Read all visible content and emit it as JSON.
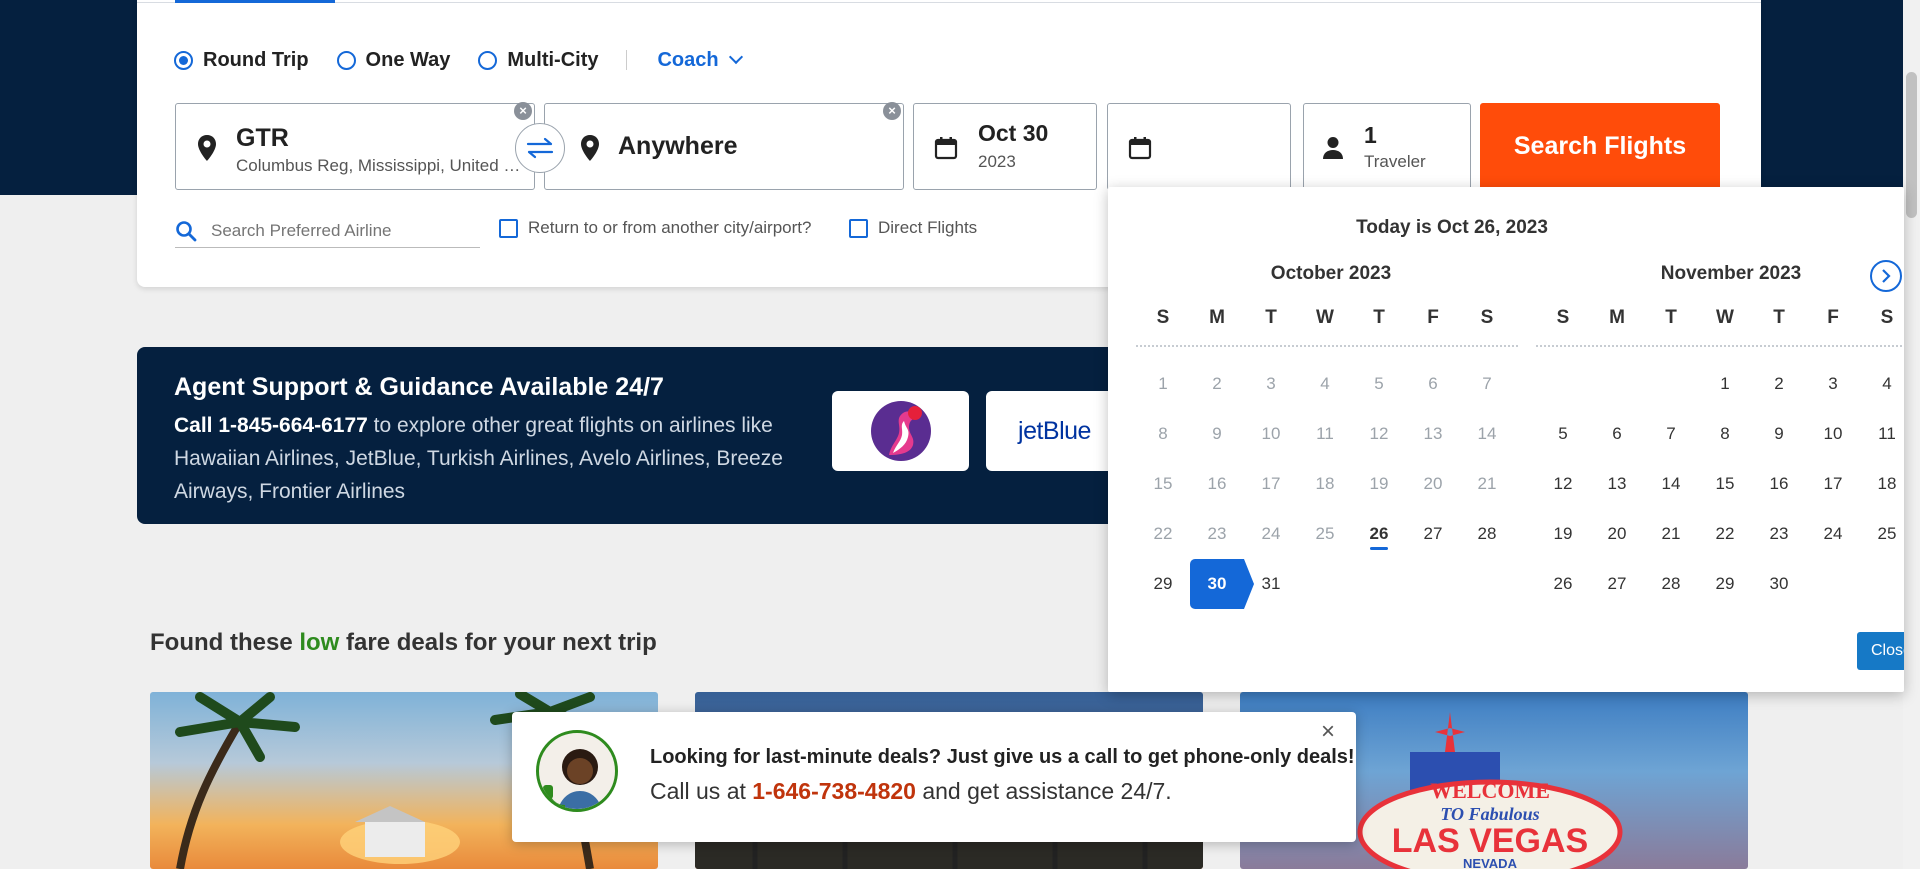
{
  "search": {
    "trip_types": [
      {
        "label": "Round Trip",
        "selected": true
      },
      {
        "label": "One Way",
        "selected": false
      },
      {
        "label": "Multi-City",
        "selected": false
      }
    ],
    "cabin": "Coach",
    "from": {
      "code": "GTR",
      "subtitle": "Columbus Reg, Mississippi, United States"
    },
    "to": {
      "value": "Anywhere"
    },
    "depart": {
      "date": "Oct 30",
      "year": "2023"
    },
    "travelers": {
      "count": "1",
      "label": "Traveler"
    },
    "search_button": "Search Flights",
    "airline_placeholder": "Search Preferred Airline",
    "return_other_label": "Return to or from another city/airport?",
    "direct_label": "Direct Flights"
  },
  "banner": {
    "title": "Agent Support & Guidance Available 24/7",
    "call_prefix": "Call 1-845-664-6177",
    "body": " to explore other great flights on airlines like Hawaiian Airlines, JetBlue, Turkish Airlines, Avelo Airlines, Breeze Airways, Frontier Airlines",
    "logos": [
      "hawaiian-airlines",
      "jetBlue"
    ],
    "jetblue_text": "jetBlue"
  },
  "deals": {
    "title_pre": "Found these ",
    "title_low": "low",
    "title_post": " fare deals for your next trip",
    "vegas_sign": {
      "welcome": "WELCOME",
      "to": "TO Fabulous",
      "city": "LAS VEGAS",
      "state": "NEVADA"
    }
  },
  "popup": {
    "title": "Looking for last-minute deals? Just give us a call to get phone-only deals!",
    "text_pre": "Call us at ",
    "phone": "1-646-738-4820",
    "text_post": " and get assistance 24/7."
  },
  "calendar": {
    "today_text": "Today is Oct 26, 2023",
    "dow": [
      "S",
      "M",
      "T",
      "W",
      "T",
      "F",
      "S"
    ],
    "months": [
      {
        "title": "October 2023",
        "first_weekday": 0,
        "days": 31,
        "past_until": 25,
        "today": 26,
        "selected": 30
      },
      {
        "title": "November 2023",
        "first_weekday": 3,
        "days": 30,
        "past_until": 0,
        "today": null,
        "selected": null
      }
    ],
    "close_label": "Close"
  },
  "colors": {
    "navy": "#05203f",
    "accent_blue": "#1468d8",
    "search_orange": "#ff4c0a",
    "low_green": "#2e8b1e",
    "phone_red": "#c0340c"
  }
}
